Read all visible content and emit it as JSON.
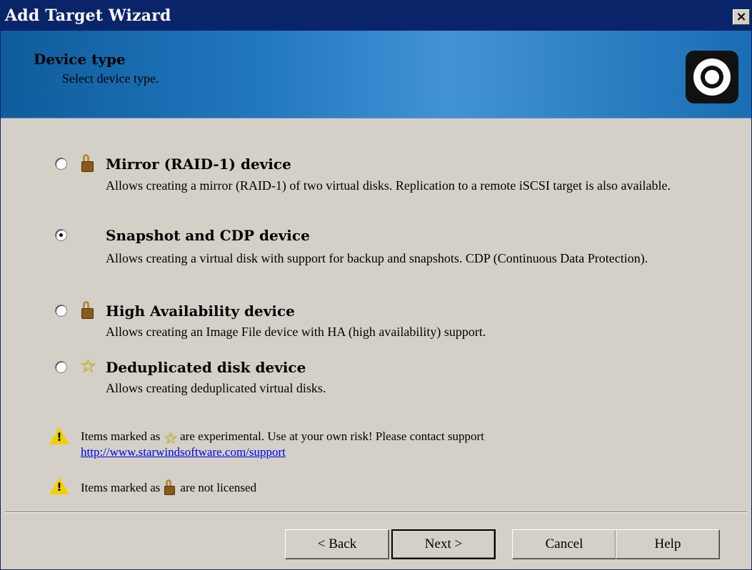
{
  "window": {
    "title": "Add Target Wizard",
    "close_glyph": "×"
  },
  "header": {
    "title": "Device type",
    "subtitle": "Select device type.",
    "logo_icon": "target-ring-icon"
  },
  "options": [
    {
      "title": "Mirror (RAID-1) device",
      "description": "Allows creating a mirror (RAID-1) of two virtual disks. Replication to a remote iSCSI target is also available.",
      "selected": false,
      "icon": "lock-icon"
    },
    {
      "title": "Snapshot and CDP device",
      "description": "Allows creating a virtual disk with support for backup and snapshots. CDP (Continuous Data Protection).",
      "selected": true,
      "icon": ""
    },
    {
      "title": "High Availability device",
      "description": "Allows creating an Image File device with HA (high availability) support.",
      "selected": false,
      "icon": "lock-icon"
    },
    {
      "title": "Deduplicated disk device",
      "description": "Allows creating deduplicated virtual disks.",
      "selected": false,
      "icon": "star-icon"
    }
  ],
  "notes": {
    "experimental_prefix": "Items marked as",
    "experimental_suffix": "are experimental. Use at your own risk! Please contact support",
    "support_link": "http://www.starwindsoftware.com/support",
    "license_prefix": "Items marked as",
    "license_suffix": "are not licensed"
  },
  "buttons": {
    "back": "< Back",
    "next": "Next >",
    "cancel": "Cancel",
    "help": "Help"
  },
  "colors": {
    "titlebar": "#0a246a",
    "header_accent": "#2278bf",
    "dialog_bg": "#d4d0c8",
    "warning": "#f0d000",
    "star": "#f0e060"
  }
}
